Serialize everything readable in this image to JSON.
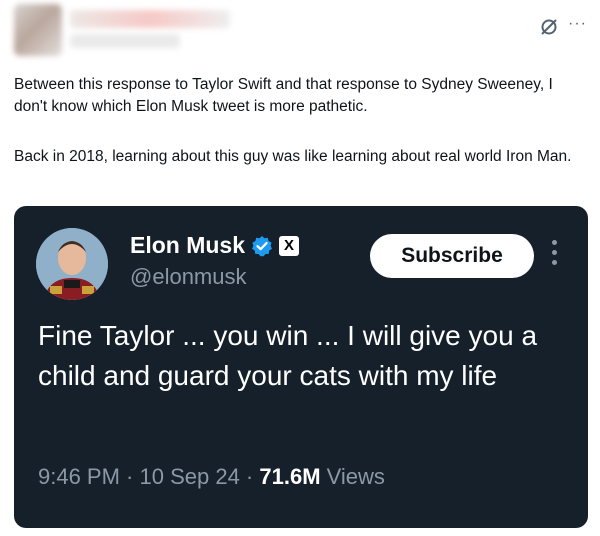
{
  "post": {
    "text_paragraph_1": "Between this response to Taylor Swift and that response to Sydney Sweeney, I don't know which Elon Musk tweet is more pathetic.",
    "text_paragraph_2": "Back in 2018, learning about this guy was like learning about real world Iron Man.",
    "more_label": "···"
  },
  "embedded_tweet": {
    "name": "Elon Musk",
    "handle": "@elonmusk",
    "subscribe_label": "Subscribe",
    "body": "Fine Taylor ... you win ... I will give you a child and guard your cats with my life",
    "time": "9:46 PM",
    "separator": " · ",
    "date": "10 Sep 24",
    "views_count": "71.6M",
    "views_label": " Views",
    "x_logo": "X"
  },
  "colors": {
    "embed_background": "#15202b",
    "verified_blue": "#1d9bf0",
    "muted_text": "#8b98a5"
  }
}
